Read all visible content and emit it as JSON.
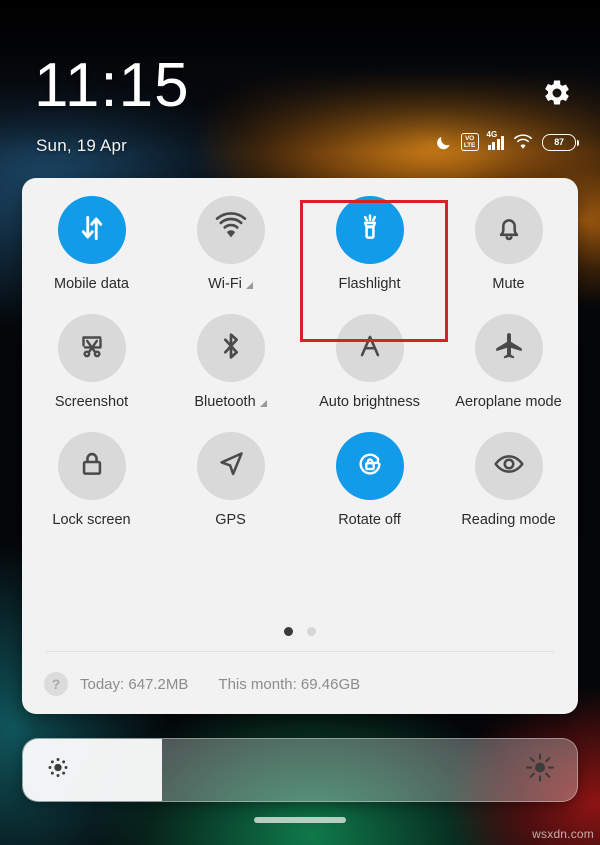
{
  "status_bar": {
    "time": "11:15",
    "date": "Sun, 19 Apr",
    "settings_icon": "gear-icon",
    "icons": [
      {
        "name": "do-not-disturb-moon-icon",
        "label": "DND"
      },
      {
        "name": "volte-icon",
        "line1": "VO",
        "line2": "LTE"
      },
      {
        "name": "mobile-signal-icon",
        "network": "4G"
      },
      {
        "name": "wifi-icon",
        "label": "WiFi"
      },
      {
        "name": "battery-icon",
        "level": "87"
      }
    ]
  },
  "quick_settings": {
    "tiles": [
      {
        "label": "Mobile data",
        "icon": "data-transfer-icon",
        "active": true,
        "expand": false
      },
      {
        "label": "Wi-Fi",
        "icon": "wifi-icon",
        "active": false,
        "expand": true
      },
      {
        "label": "Flashlight",
        "icon": "flashlight-icon",
        "active": true,
        "expand": false,
        "highlighted": true
      },
      {
        "label": "Mute",
        "icon": "bell-icon",
        "active": false,
        "expand": false
      },
      {
        "label": "Screenshot",
        "icon": "scissors-crop-icon",
        "active": false,
        "expand": false
      },
      {
        "label": "Bluetooth",
        "icon": "bluetooth-icon",
        "active": false,
        "expand": true
      },
      {
        "label": "Auto brightness",
        "icon": "letter-a-icon",
        "active": false,
        "expand": false
      },
      {
        "label": "Aeroplane mode",
        "icon": "airplane-icon",
        "active": false,
        "expand": false
      },
      {
        "label": "Lock screen",
        "icon": "padlock-icon",
        "active": false,
        "expand": false
      },
      {
        "label": "GPS",
        "icon": "navigation-arrow-icon",
        "active": false,
        "expand": false
      },
      {
        "label": "Rotate off",
        "icon": "rotation-lock-icon",
        "active": true,
        "expand": false
      },
      {
        "label": "Reading mode",
        "icon": "eye-icon",
        "active": false,
        "expand": false
      }
    ],
    "pager": {
      "pages": 2,
      "active": 1
    },
    "data_usage": {
      "help_icon": "question-mark-icon",
      "today_label": "Today: 647.2MB",
      "month_label": "This month: 69.46GB"
    }
  },
  "brightness": {
    "low_icon": "sun-low-icon",
    "high_icon": "sun-high-icon",
    "level_percent": 25
  },
  "home_indicator": "home-gesture-bar",
  "watermark": "wsxdn.com",
  "colors": {
    "accent_blue": "#119be9",
    "tile_inactive": "#d9d9d9",
    "card_bg": "#f2f2f2",
    "highlight_red": "#d8202a"
  }
}
